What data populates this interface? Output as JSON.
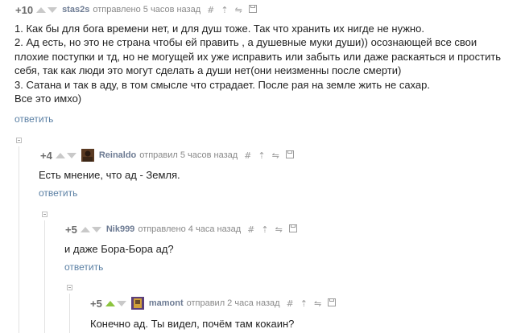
{
  "comments": [
    {
      "score": "+10",
      "user": "stas2s",
      "meta": "отправлено 5 часов назад",
      "lines": [
        "1. Как бы для бога времени нет, и для душ тоже. Так что хранить их нигде не нужно.",
        "2. Ад есть, но это не страна чтобы ей править , а душевные муки души)) осознающей все свои",
        "плохие поступки и тд, но не могущей их уже исправить или забыть или даже раскаяться и простить",
        "себя, так как люди это могут сделать а души нет(они неизменны после смерти)",
        "3. Сатана и так в аду, в том смысле что страдает. После рая на земле жить не сахар.",
        "Все это имхо)"
      ],
      "reply": "ответить"
    },
    {
      "score": "+4",
      "user": "Reinaldo",
      "meta": "отправил 5 часов назад",
      "lines": [
        "Есть мнение, что ад - Земля."
      ],
      "reply": "ответить"
    },
    {
      "score": "+5",
      "user": "Nik999",
      "meta": "отправлено 4 часа назад",
      "lines": [
        "и даже Бора-Бора ад?"
      ],
      "reply": "ответить"
    },
    {
      "score": "+5",
      "user": "mamont",
      "meta": "отправил 2 часа назад",
      "lines": [
        "Конечно ад. Ты видел, почём там кокаин?"
      ],
      "reply": ""
    }
  ],
  "tools": [
    "#",
    "⇡",
    "⇋",
    "💾"
  ],
  "colors": {
    "username": "#6d7b93",
    "reply_link": "#5b80a4",
    "upvote_active": "#8cc43f",
    "arrow_inactive": "#c9c9c9"
  }
}
